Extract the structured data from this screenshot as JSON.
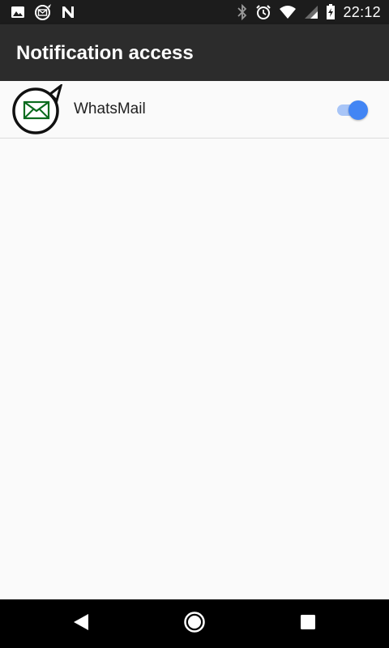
{
  "status_bar": {
    "time": "22:12",
    "left_icons": [
      "image-icon",
      "whatsmail-notification-icon",
      "n-icon"
    ],
    "right_icons": [
      "bluetooth-icon",
      "alarm-icon",
      "wifi-icon",
      "signal-icon",
      "battery-icon"
    ]
  },
  "app_bar": {
    "title": "Notification access"
  },
  "apps": [
    {
      "name": "WhatsMail",
      "icon": "whatsmail-envelope-icon",
      "enabled": true
    }
  ],
  "nav_bar": {
    "buttons": [
      "back-icon",
      "home-icon",
      "recents-icon"
    ]
  },
  "colors": {
    "status_bar": "#1c1c1c",
    "app_bar": "#2c2c2c",
    "background": "#fafafa",
    "switch_thumb": "#4285f4",
    "switch_track": "#a8c5f7",
    "app_icon_green": "#0b6b1e"
  }
}
